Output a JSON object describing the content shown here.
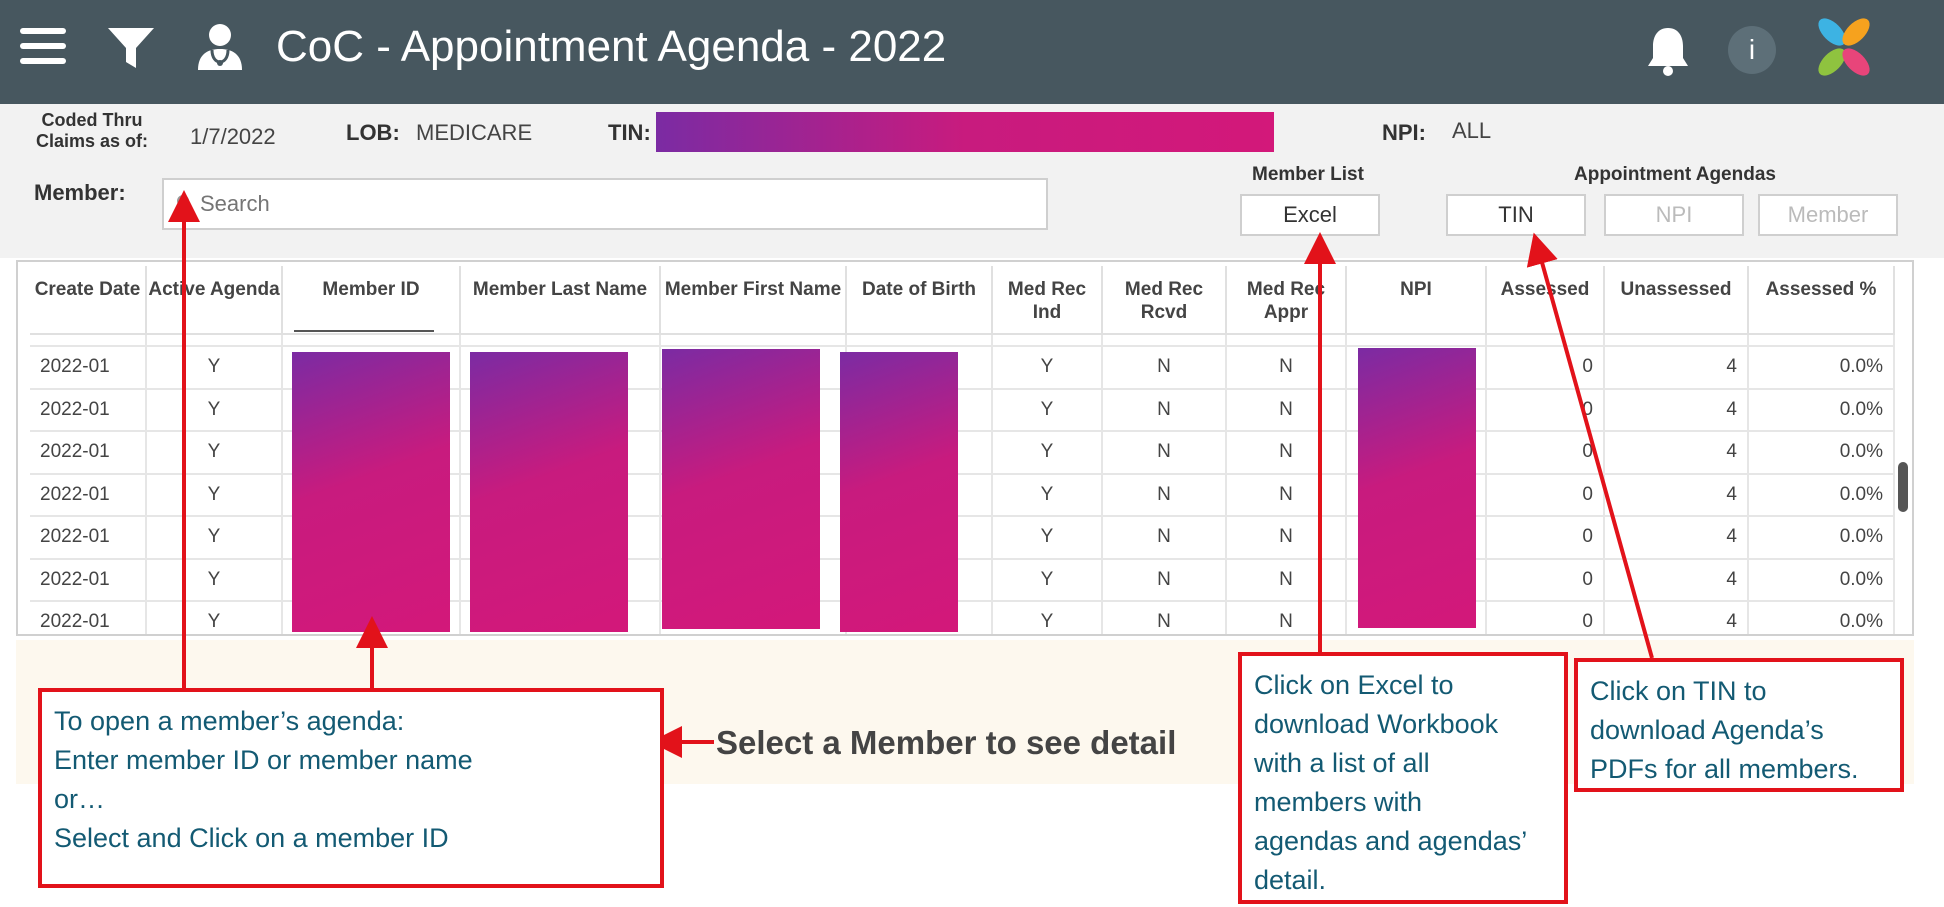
{
  "header": {
    "title": "CoC - Appointment Agenda - 2022",
    "info_glyph": "i"
  },
  "filters": {
    "coded_thru_line1": "Coded Thru",
    "coded_thru_line2": "Claims as of:",
    "coded_thru_value": "1/7/2022",
    "lob_label": "LOB:",
    "lob_value": "MEDICARE",
    "tin_label": "TIN:",
    "npi_label": "NPI:",
    "npi_value": "ALL",
    "member_label": "Member:",
    "search_placeholder": "Search",
    "member_list_label": "Member List",
    "excel_button": "Excel",
    "appointment_agendas_label": "Appointment Agendas",
    "tin_button": "TIN",
    "npi_button": "NPI",
    "member_button": "Member"
  },
  "table": {
    "columns": [
      "Create Date",
      "Active Agenda",
      "Member ID",
      "Member Last Name",
      "Member First Name",
      "Date of Birth",
      "Med Rec Ind",
      "Med Rec Rcvd",
      "Med Rec Appr",
      "NPI",
      "Assessed",
      "Unassessed",
      "Assessed %"
    ],
    "rows": [
      {
        "create_date": "2022-01",
        "active_agenda": "Y",
        "med_rec_ind": "Y",
        "med_rec_rcvd": "N",
        "med_rec_appr": "N",
        "assessed": "0",
        "unassessed": "4",
        "assessed_pct": "0.0%"
      },
      {
        "create_date": "2022-01",
        "active_agenda": "Y",
        "med_rec_ind": "Y",
        "med_rec_rcvd": "N",
        "med_rec_appr": "N",
        "assessed": "0",
        "unassessed": "4",
        "assessed_pct": "0.0%"
      },
      {
        "create_date": "2022-01",
        "active_agenda": "Y",
        "med_rec_ind": "Y",
        "med_rec_rcvd": "N",
        "med_rec_appr": "N",
        "assessed": "0",
        "unassessed": "4",
        "assessed_pct": "0.0%"
      },
      {
        "create_date": "2022-01",
        "active_agenda": "Y",
        "med_rec_ind": "Y",
        "med_rec_rcvd": "N",
        "med_rec_appr": "N",
        "assessed": "0",
        "unassessed": "4",
        "assessed_pct": "0.0%"
      },
      {
        "create_date": "2022-01",
        "active_agenda": "Y",
        "med_rec_ind": "Y",
        "med_rec_rcvd": "N",
        "med_rec_appr": "N",
        "assessed": "0",
        "unassessed": "4",
        "assessed_pct": "0.0%"
      },
      {
        "create_date": "2022-01",
        "active_agenda": "Y",
        "med_rec_ind": "Y",
        "med_rec_rcvd": "N",
        "med_rec_appr": "N",
        "assessed": "0",
        "unassessed": "4",
        "assessed_pct": "0.0%"
      },
      {
        "create_date": "2022-01",
        "active_agenda": "Y",
        "med_rec_ind": "Y",
        "med_rec_rcvd": "N",
        "med_rec_appr": "N",
        "assessed": "0",
        "unassessed": "4",
        "assessed_pct": "0.0%"
      }
    ]
  },
  "detail_message": "Select a Member to see detail",
  "callouts": {
    "open_agenda": [
      "To open a member’s agenda:",
      "Enter member ID or member name",
      "or…",
      "Select and Click on a member ID"
    ],
    "excel": [
      "Click on Excel to",
      "download Workbook",
      "with a list of all",
      "members with",
      "agendas and agendas’",
      "detail."
    ],
    "tin": [
      "Click on TIN to",
      "download Agenda’s",
      "PDFs for all members."
    ]
  },
  "colors": {
    "header_bg": "#47575f",
    "redaction_start": "#7b2ba3",
    "redaction_end": "#d3187a",
    "callout_border": "#e2121a",
    "callout_text": "#135a73",
    "detail_bg": "#fdf8ee"
  },
  "icons": [
    "hamburger-menu-icon",
    "filter-icon",
    "doctor-icon",
    "bell-icon",
    "info-icon",
    "app-logo-icon",
    "search-icon"
  ]
}
